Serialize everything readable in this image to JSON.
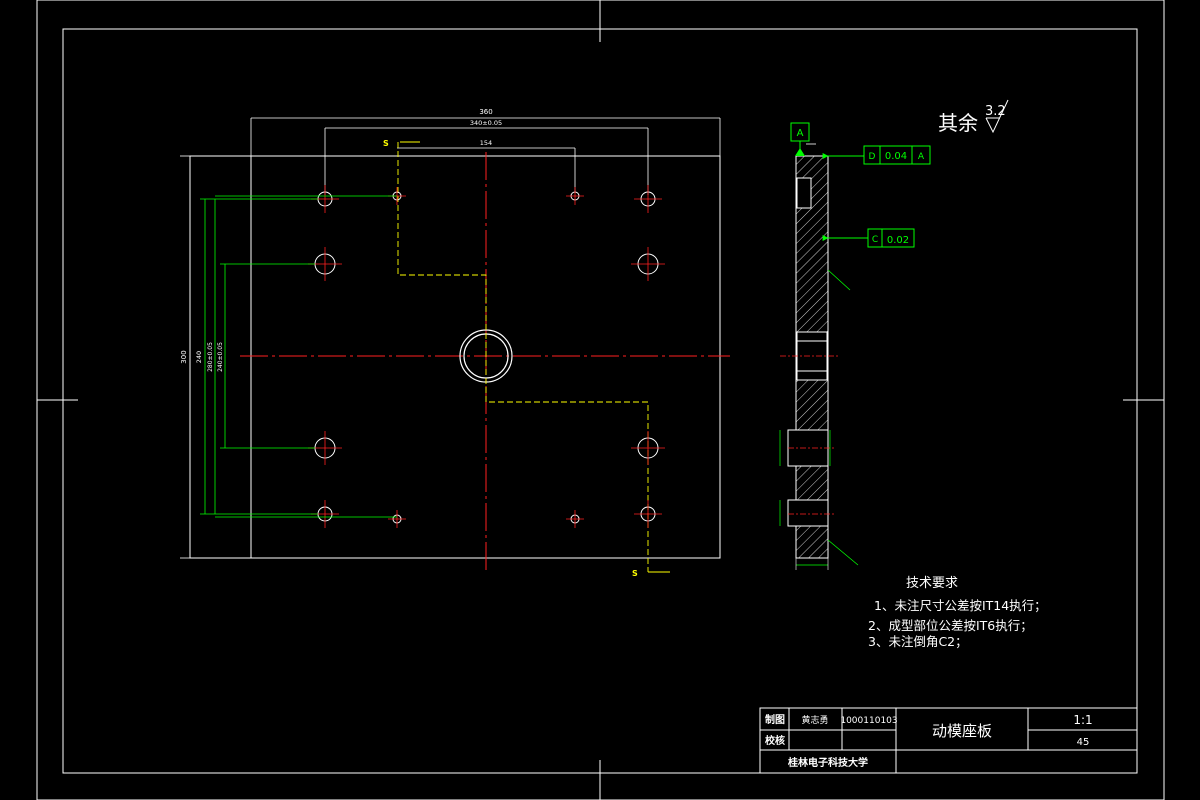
{
  "roughness": {
    "label": "其余",
    "value": "3.2"
  },
  "datum": {
    "letter": "A"
  },
  "tolerances": {
    "parallelism": {
      "ref": "D",
      "value": "0.04",
      "datum": "A"
    },
    "flatness": {
      "ref": "C",
      "value": "0.02"
    }
  },
  "section_marks": {
    "s_top": "S",
    "s_bottom": "S"
  },
  "dimensions": {
    "overall_width": "360",
    "hole_span": "340±0.05",
    "inner_span": "154",
    "overall_height": "300",
    "left_h1": "240",
    "left_h2": "280±0.05",
    "left_h3": "240±0.05"
  },
  "tech_requirements": {
    "title": "技术要求",
    "items": [
      "1、未注尺寸公差按IT14执行；",
      "2、成型部位公差按IT6执行；",
      "3、未注倒角C2；"
    ]
  },
  "title_block": {
    "drawn_label": "制图",
    "drawn_name": "黄志勇",
    "drawing_no": "1000110103",
    "checked_label": "校核",
    "part_name": "动模座板",
    "scale": "1:1",
    "material": "45",
    "school": "桂林电子科技大学"
  }
}
